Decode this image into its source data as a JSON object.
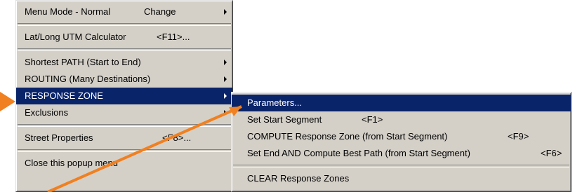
{
  "main_menu": {
    "menu_mode": {
      "label": "Menu Mode - Normal",
      "shortcut": "Change"
    },
    "calculator": {
      "label": "Lat/Long UTM Calculator",
      "shortcut": "<F11>..."
    },
    "shortest_path": {
      "label": "Shortest PATH (Start to End)"
    },
    "routing": {
      "label": "ROUTING (Many Destinations)"
    },
    "response_zone": {
      "label": "RESPONSE ZONE"
    },
    "exclusions": {
      "label": "Exclusions"
    },
    "street_properties": {
      "label": "Street Properties",
      "shortcut": "<F8>..."
    },
    "close_popup": {
      "label": "Close this popup menu"
    }
  },
  "sub_menu": {
    "parameters": {
      "label": "Parameters..."
    },
    "set_start": {
      "label": "Set Start Segment",
      "shortcut": "<F1>"
    },
    "compute_zone": {
      "label": "COMPUTE Response Zone (from Start Segment)",
      "shortcut": "<F9>"
    },
    "set_end": {
      "label": "Set End AND Compute Best Path (from Start Segment)",
      "shortcut": "<F6>"
    },
    "clear_zones": {
      "label": "CLEAR Response Zones"
    }
  },
  "colors": {
    "highlight": "#0a246a",
    "annotation": "#f08020",
    "menu_bg": "#d4d0c8"
  },
  "icons": [
    "submenu-arrow-icon",
    "pointer-arrow-icon"
  ]
}
